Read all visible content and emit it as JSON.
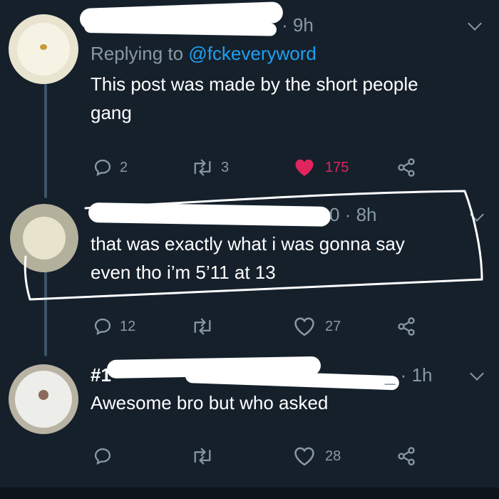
{
  "colors": {
    "background": "#15202b",
    "text": "#ffffff",
    "secondary": "#8899a6",
    "link": "#1da1f2",
    "like": "#e0245e"
  },
  "tweets": [
    {
      "time": "· 9h",
      "reply_prefix": "Replying to",
      "reply_handle": "@fckeveryword",
      "text_lines": [
        "This post was made by the short people",
        "gang"
      ],
      "replies": "2",
      "retweets": "3",
      "likes": "175",
      "liked": true
    },
    {
      "time": "0 · 8h",
      "text_lines": [
        "that was exactly what i was gonna say",
        "even tho i’m 5’11 at 13"
      ],
      "replies": "12",
      "retweets": "",
      "likes": "27",
      "liked": false
    },
    {
      "name_fragment": "#1",
      "time": "_ · 1h",
      "text_lines": [
        "Awesome bro but who asked"
      ],
      "replies": "",
      "retweets": "",
      "likes": "28",
      "liked": false
    }
  ],
  "icons": [
    "reply-icon",
    "retweet-icon",
    "like-icon",
    "share-icon",
    "chevron-down-icon"
  ]
}
